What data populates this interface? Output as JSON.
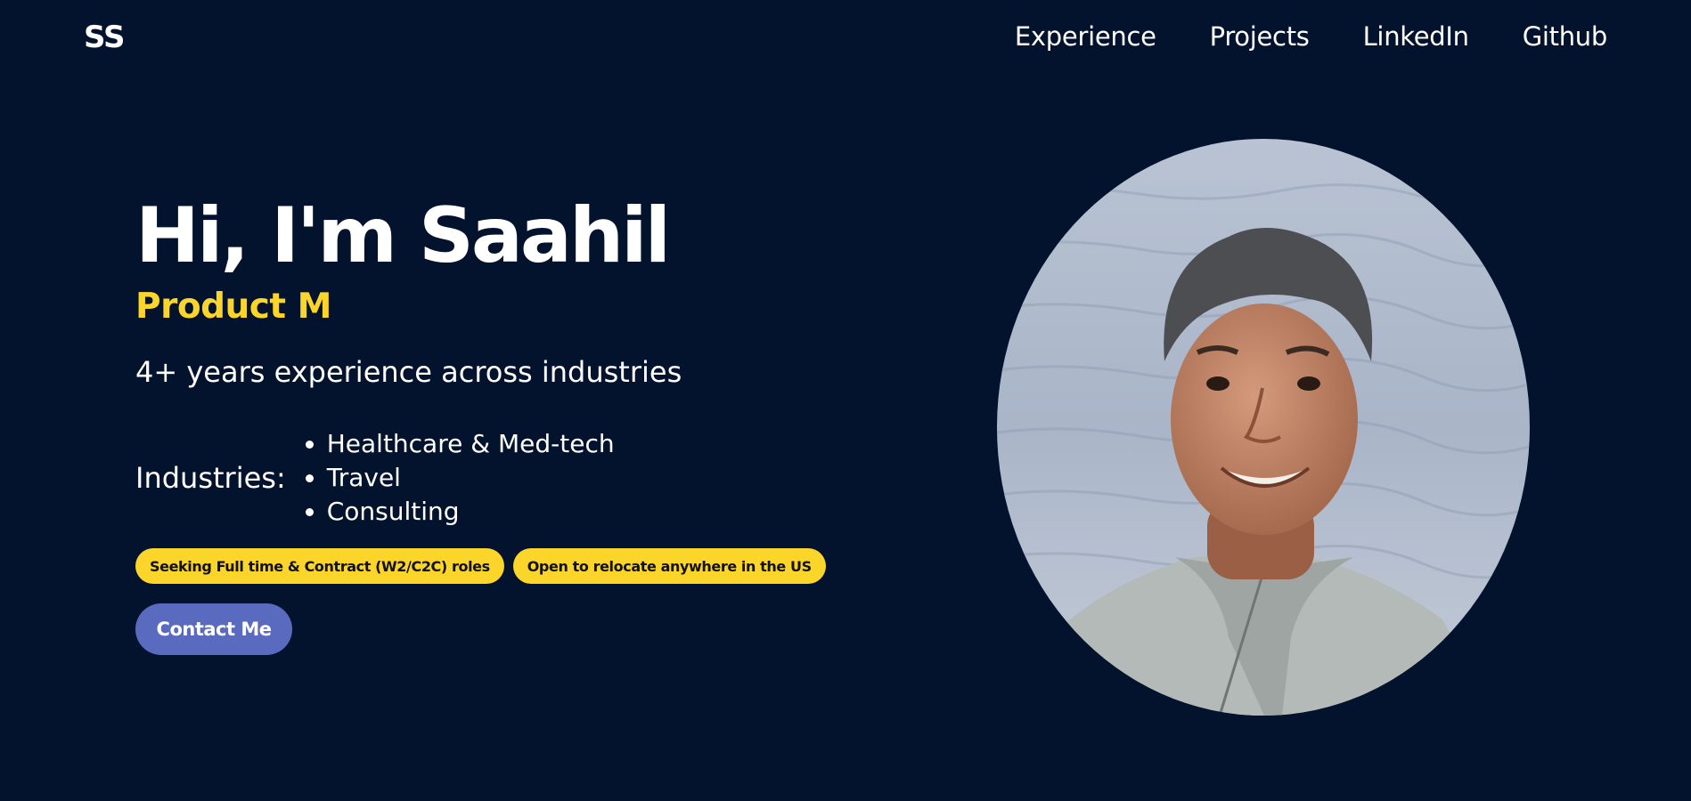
{
  "header": {
    "logo": "SS",
    "nav": [
      "Experience",
      "Projects",
      "LinkedIn",
      "Github"
    ]
  },
  "hero": {
    "greeting": "Hi, I'm Saahil",
    "role": "Product M",
    "experience": "4+ years experience across industries",
    "industries_label": "Industries:",
    "industries": [
      "Healthcare & Med-tech",
      "Travel",
      "Consulting"
    ],
    "tags": [
      "Seeking Full time & Contract (W2/C2C) roles",
      "Open to relocate anywhere in the US"
    ],
    "contact_label": "Contact Me"
  },
  "colors": {
    "background": "#03132d",
    "accent": "#fcd52b",
    "button": "#5a6bbf"
  }
}
